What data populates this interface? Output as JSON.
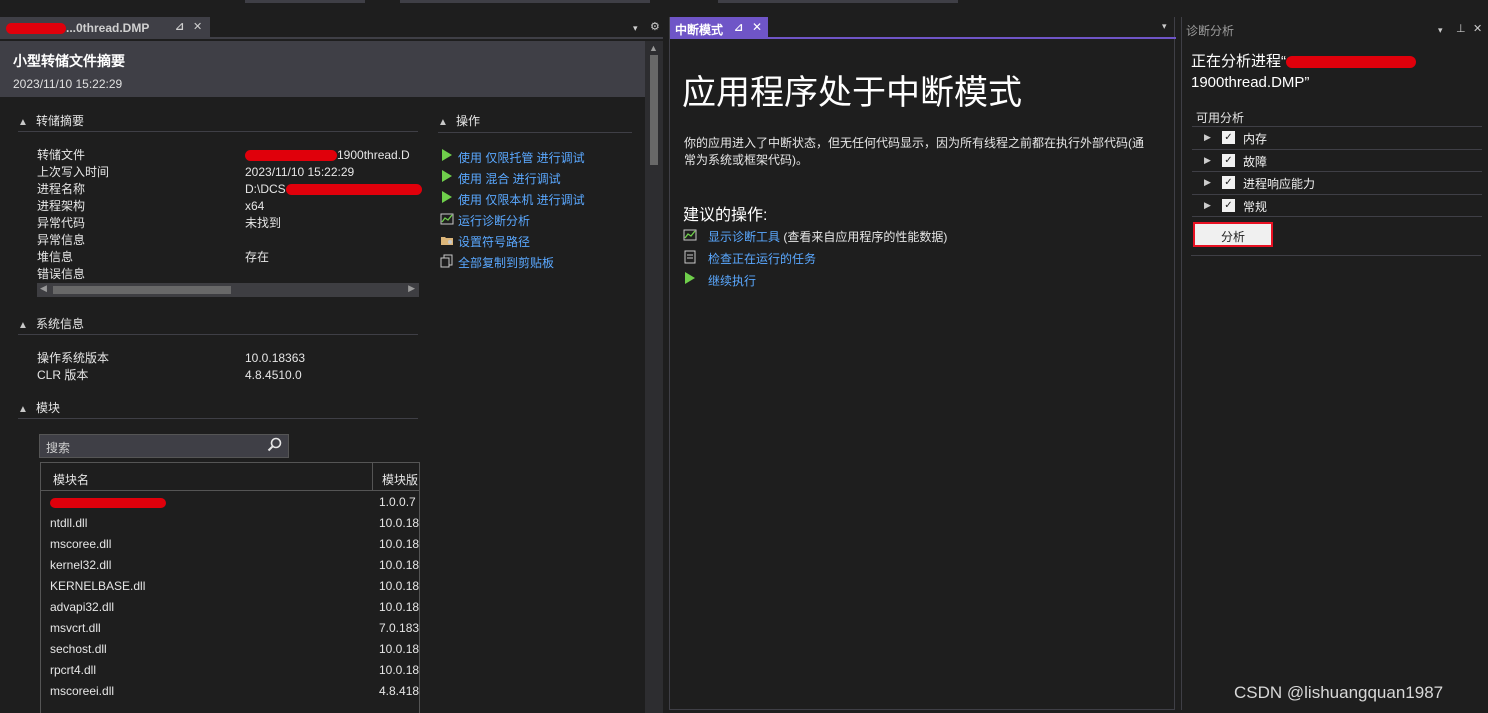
{
  "dump_pane": {
    "tab": {
      "label": "...0thread.DMP",
      "pin": "⊿",
      "close": "✕"
    },
    "strip_menu": "▾",
    "strip_settings": "⚙",
    "header": {
      "title": "小型转储文件摘要",
      "date": "2023/11/10 15:22:29"
    },
    "dump_summary": {
      "title": "转储摘要",
      "rows": [
        {
          "key": "转储文件",
          "value": "1900thread.D"
        },
        {
          "key": "上次写入时间",
          "value": "2023/11/10 15:22:29"
        },
        {
          "key": "进程名称",
          "value": "D:\\DCS"
        },
        {
          "key": "进程架构",
          "value": "x64"
        },
        {
          "key": "异常代码",
          "value": "未找到"
        },
        {
          "key": "异常信息",
          "value": ""
        },
        {
          "key": "堆信息",
          "value": "存在"
        },
        {
          "key": "错误信息",
          "value": ""
        }
      ]
    },
    "actions": {
      "title": "操作",
      "items": [
        {
          "label": "使用 仅限托管 进行调试",
          "icon": "play-icon"
        },
        {
          "label": "使用 混合 进行调试",
          "icon": "play-icon"
        },
        {
          "label": "使用 仅限本机 进行调试",
          "icon": "play-icon"
        },
        {
          "label": "运行诊断分析",
          "icon": "diagnostics-icon"
        },
        {
          "label": "设置符号路径",
          "icon": "folder-settings-icon"
        },
        {
          "label": "全部复制到剪贴板",
          "icon": "copy-icon"
        }
      ]
    },
    "system_info": {
      "title": "系统信息",
      "rows": [
        {
          "key": "操作系统版本",
          "value": "10.0.18363"
        },
        {
          "key": "CLR 版本",
          "value": "4.8.4510.0"
        }
      ]
    },
    "modules": {
      "title": "模块",
      "search_placeholder": "搜索",
      "columns": [
        "模块名",
        "模块版"
      ],
      "rows": [
        {
          "name": "",
          "version": "1.0.0.7"
        },
        {
          "name": "ntdll.dll",
          "version": "10.0.18"
        },
        {
          "name": "mscoree.dll",
          "version": "10.0.18"
        },
        {
          "name": "kernel32.dll",
          "version": "10.0.18"
        },
        {
          "name": "KERNELBASE.dll",
          "version": "10.0.18"
        },
        {
          "name": "advapi32.dll",
          "version": "10.0.18"
        },
        {
          "name": "msvcrt.dll",
          "version": "7.0.183"
        },
        {
          "name": "sechost.dll",
          "version": "10.0.18"
        },
        {
          "name": "rpcrt4.dll",
          "version": "10.0.18"
        },
        {
          "name": "mscoreei.dll",
          "version": "4.8.418"
        }
      ]
    }
  },
  "break_pane": {
    "tab": {
      "label": "中断模式",
      "pin": "⊿",
      "close": "✕"
    },
    "menu": "▾",
    "title": "应用程序处于中断模式",
    "description": "你的应用进入了中断状态，但无任何代码显示，因为所有线程之前都在执行外部代码(通常为系统或框架代码)。",
    "suggested_title": "建议的操作:",
    "actions": [
      {
        "label": "显示诊断工具",
        "tail": " (查看来自应用程序的性能数据)",
        "icon": "chart-icon"
      },
      {
        "label": "检查正在运行的任务",
        "tail": "",
        "icon": "task-icon"
      },
      {
        "label": "继续执行",
        "tail": "",
        "icon": "play-icon"
      }
    ]
  },
  "diag_pane": {
    "title": "诊断分析",
    "menu": "▾",
    "pin": "⊥",
    "close": "✕",
    "analyzing_prefix": "正在分析进程“",
    "analyzing_suffix": "1900thread.DMP”",
    "available_title": "可用分析",
    "items": [
      {
        "label": "内存",
        "checked": true
      },
      {
        "label": "故障",
        "checked": true
      },
      {
        "label": "进程响应能力",
        "checked": true
      },
      {
        "label": "常规",
        "checked": true
      }
    ],
    "analyze_button": "分析"
  },
  "watermark": "CSDN @lishuangquan1987",
  "colors": {
    "background": "#1e1e1e",
    "panel_header": "#3f3f46",
    "link": "#5aa8ff",
    "active_tab": "#6f55c7",
    "highlight_border": "#e81123",
    "redaction": "#e0000b"
  }
}
